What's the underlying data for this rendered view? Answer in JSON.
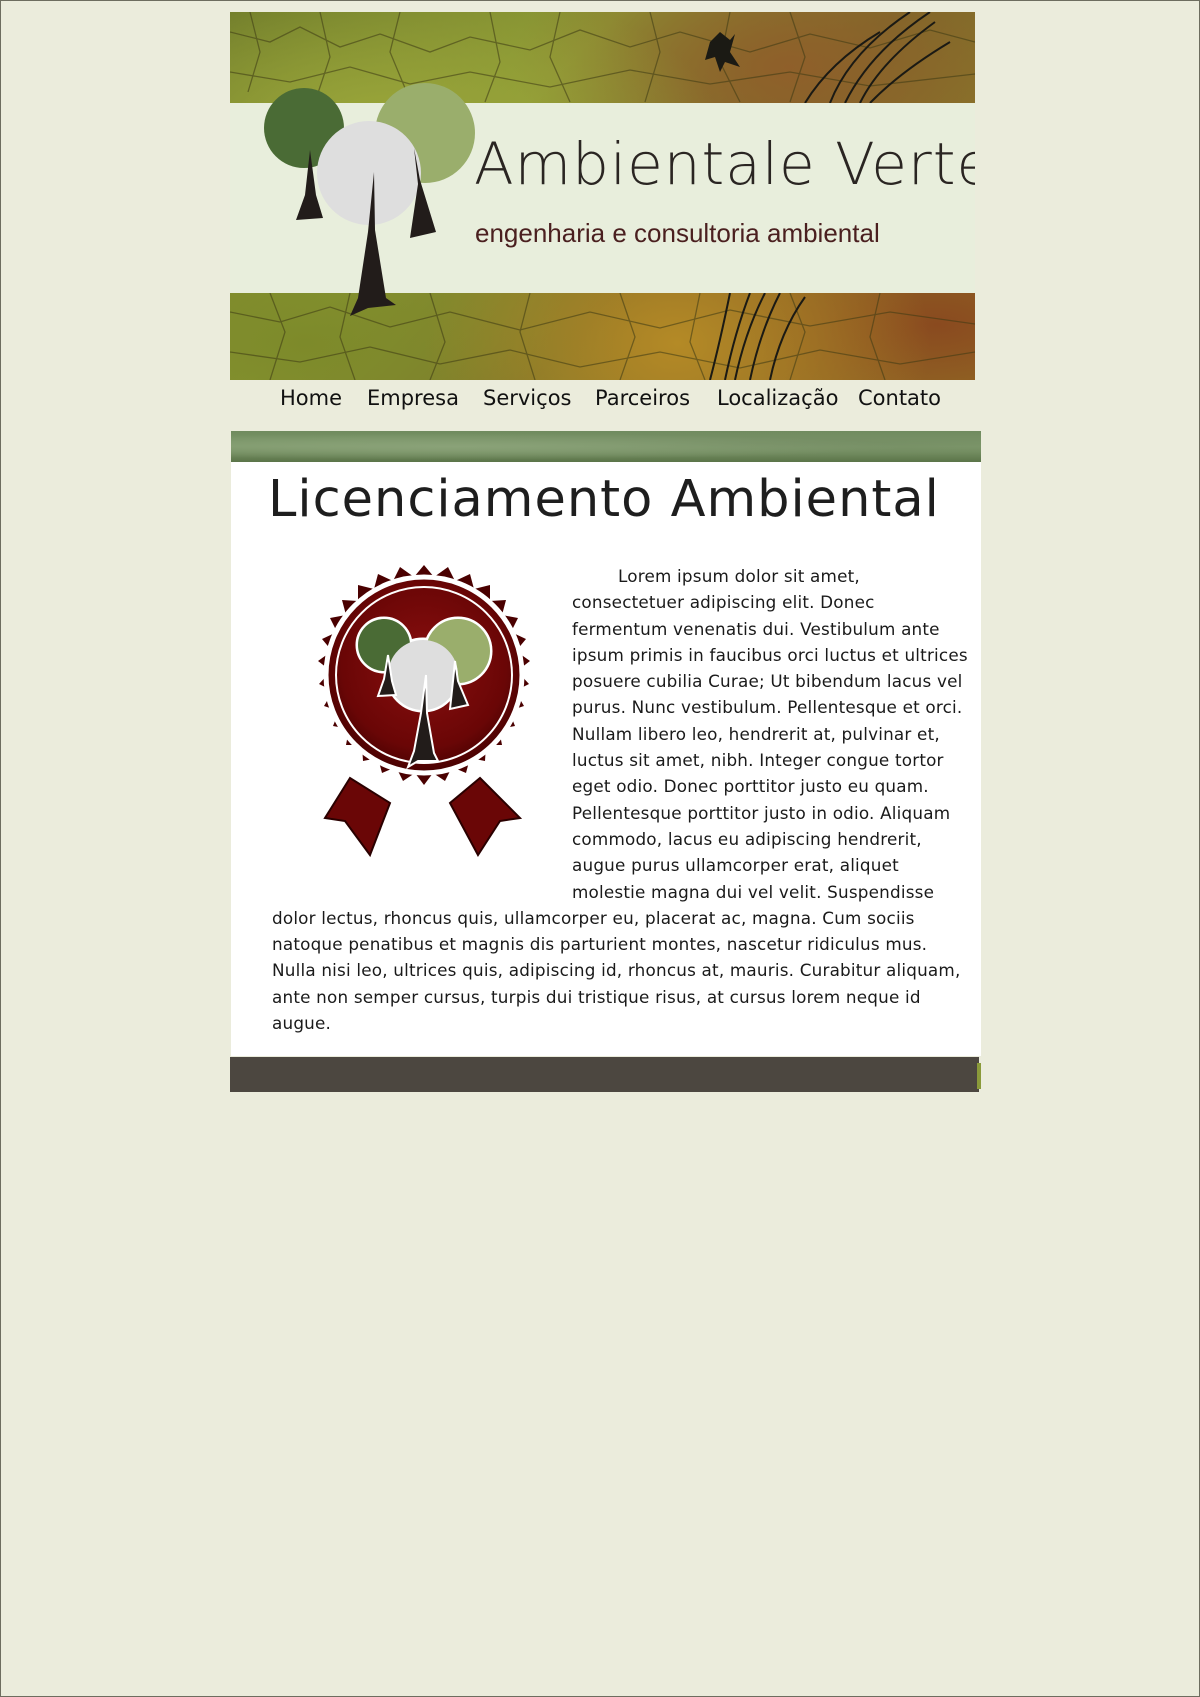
{
  "site": {
    "brand_name": "Ambientale Verte",
    "tagline": "engenharia e consultoria ambiental"
  },
  "nav": {
    "items": [
      {
        "label": "Home"
      },
      {
        "label": "Empresa"
      },
      {
        "label": "Serviços"
      },
      {
        "label": "Parceiros"
      },
      {
        "label": "Localização"
      },
      {
        "label": "Contato"
      }
    ]
  },
  "main": {
    "title": "Licenciamento Ambiental",
    "body": "Lorem ipsum dolor sit amet, consectetuer adipiscing elit. Donec fermentum venenatis dui. Vestibulum ante ipsum primis in faucibus orci luctus et ultrices posuere cubilia Curae; Ut bibendum lacus vel purus. Nunc vestibulum. Pellentesque et orci. Nullam libero leo, hendrerit at, pulvinar et, luctus sit amet, nibh. Integer congue tortor eget odio. Donec porttitor justo eu quam. Pellentesque porttitor justo in odio. Aliquam commodo, lacus eu adipiscing hendrerit, augue purus ullamcorper erat, aliquet molestie magna dui vel velit. Suspendisse dolor lectus, rhoncus quis, ullamcorper eu, placerat ac, magna. Cum sociis natoque penatibus et magnis dis parturient montes, nascetur ridiculus mus. Nulla nisi leo, ultrices quis, adipiscing id, rhoncus at, mauris. Curabitur aliquam, ante non semper cursus, turpis dui tristique risus, at cursus lorem neque id augue."
  },
  "colors": {
    "page_background": "#ebecdc",
    "banner_band": "#e8eedc",
    "content_background": "#ffffff",
    "footer": "#4c4740",
    "seal_red": "#7a0a0a",
    "tree_dark_green": "#4a6b35",
    "tree_light_green": "#9aae6c",
    "tree_gray": "#dedede",
    "trunk": "#221c1a"
  },
  "icons": {
    "banner_logo": "tree-logo-icon",
    "seal": "award-seal-icon"
  }
}
